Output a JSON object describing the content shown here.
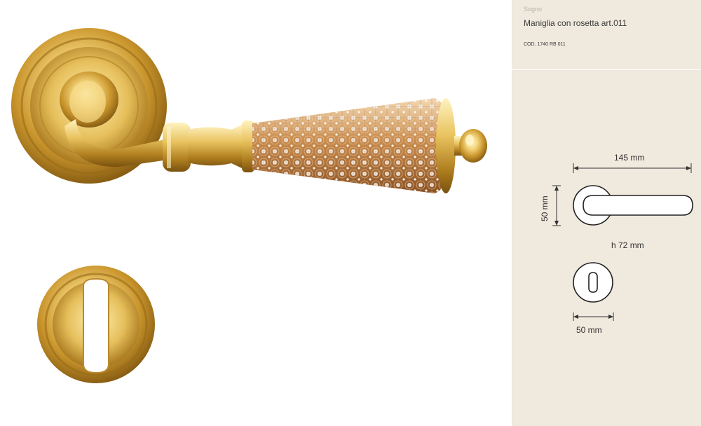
{
  "product": {
    "collection": "Sogno",
    "title": "Maniglia con rosetta art.011",
    "code": "COD. 1740 RB 011"
  },
  "dimensions": {
    "handle_length": "145 mm",
    "rose_diameter": "50 mm",
    "height": "h 72 mm",
    "escutcheon_diameter": "50 mm"
  },
  "colors": {
    "panel_background": "#efe9de",
    "finish_gold": "#d9b04a"
  }
}
